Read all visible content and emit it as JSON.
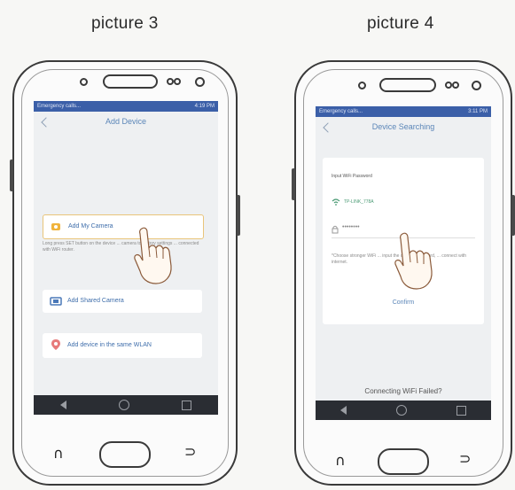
{
  "captions": {
    "left": "picture 3",
    "right": "picture 4"
  },
  "phone_left": {
    "status_left": "Emergency calls...",
    "status_right": "4:19 PM",
    "title": "Add Device",
    "add_my_camera": "Add My Camera",
    "add_my_camera_desc": "Long press SET button on the device ... camera to factory settings ... connected with WiFi router.",
    "add_shared_camera": "Add Shared Camera",
    "add_same_wlan": "Add device in the same WLAN"
  },
  "phone_right": {
    "status_left": "Emergency calls...",
    "status_right": "3:11 PM",
    "title": "Device Searching",
    "input_label": "Input WiFi Password",
    "wifi_name": "TP-LINK_778A",
    "password_mask": "••••••••",
    "note": "*Choose stronger WiFi ... input the correct password, ... connect with internet.",
    "confirm": "Confirm",
    "failed": "Connecting WiFi Failed?"
  },
  "colors": {
    "status_bar": "#3b5fa8",
    "accent": "#5b86b8",
    "navbar": "#2a2d33"
  },
  "icons": [
    "back-chevron",
    "camera-icon",
    "shared-camera-icon",
    "location-pin-icon",
    "wifi-icon",
    "lock-icon",
    "pointing-hand"
  ]
}
